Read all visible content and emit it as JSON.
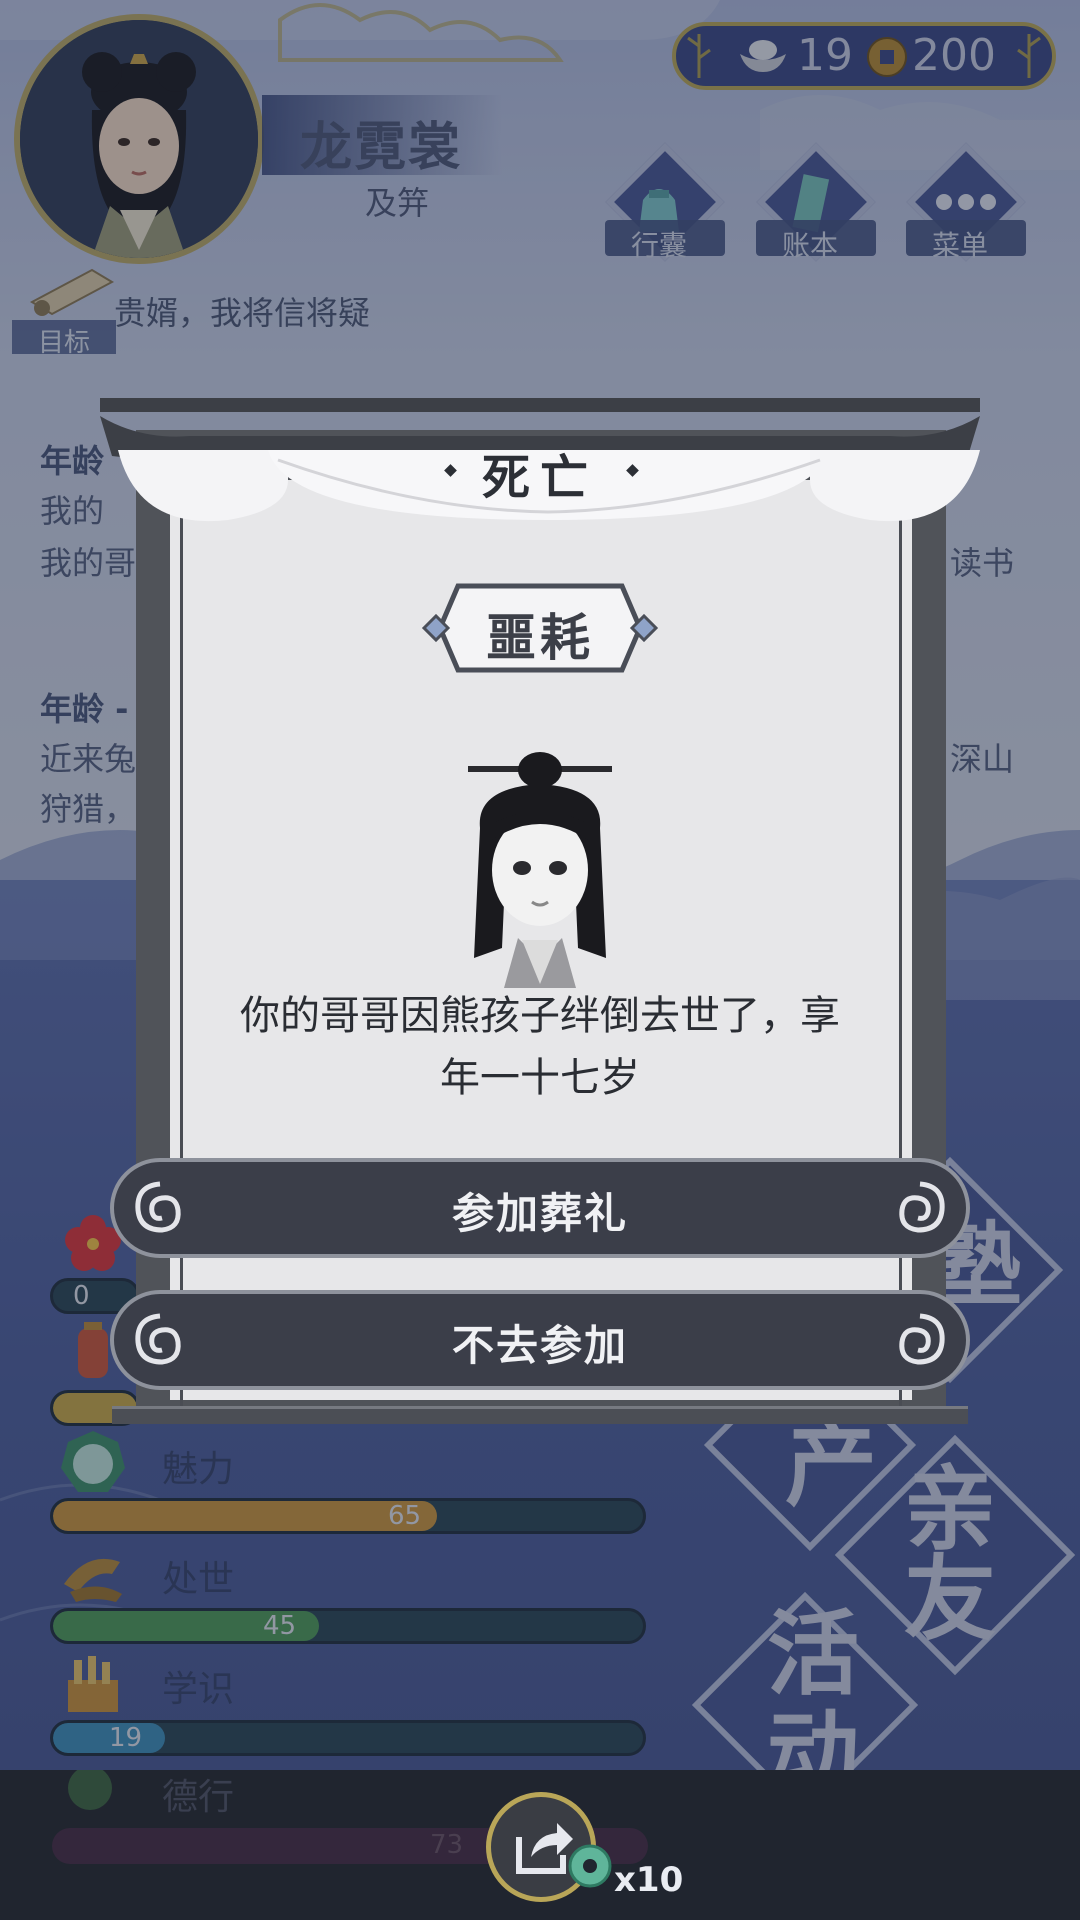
{
  "hud": {
    "player_name": "龙霓裳",
    "player_age": "及笄",
    "silver": "19",
    "coins": "200",
    "menu": [
      "行囊",
      "账本",
      "菜单"
    ],
    "goal_label": "目标",
    "goal_text": "贵婿，我将信将疑"
  },
  "log": {
    "entry1": {
      "age": "年龄",
      "line1": "我的",
      "line2": "我的哥",
      "line2_end": "读书"
    },
    "entry2": {
      "age": "年龄 -",
      "line1": "近来兔",
      "line1_end": "深山",
      "line2": "狩猎，"
    }
  },
  "stats": [
    {
      "name": "",
      "value": 0,
      "display": "0",
      "color": "#6a8fb0"
    },
    {
      "name": "",
      "value": 0,
      "display": "",
      "color": "#c7a84a"
    },
    {
      "name": "魅力",
      "value": 65,
      "display": "65",
      "color": "#c9953f"
    },
    {
      "name": "处世",
      "value": 45,
      "display": "45",
      "color": "#4f9a5a"
    },
    {
      "name": "学识",
      "value": 19,
      "display": "19",
      "color": "#3f8fb8"
    },
    {
      "name": "德行",
      "value": 73,
      "display": "73",
      "color": "#7a3a62"
    }
  ],
  "side_actions": {
    "school_char": "塾",
    "property_char": "产",
    "friends": "亲友",
    "activity": "活动"
  },
  "bottom": {
    "ticket_count": "x10"
  },
  "modal": {
    "title": "死亡",
    "tag": "噩耗",
    "message_line1": "你的哥哥因熊孩子绊倒去世了，享",
    "message_line2": "年一十七岁",
    "attend_button": "参加葬礼",
    "decline_button": "不去参加"
  },
  "colors": {
    "modal_paper": "#e7e7e9",
    "modal_frame": "#505359",
    "button_bg": "#3b3e49",
    "gold_trim": "#b9a658"
  },
  "icons": [
    "silver-ingot-icon",
    "copper-coin-icon",
    "bag-icon",
    "ledger-icon",
    "menu-dots-icon",
    "scroll-icon",
    "share-icon",
    "jade-icon"
  ]
}
